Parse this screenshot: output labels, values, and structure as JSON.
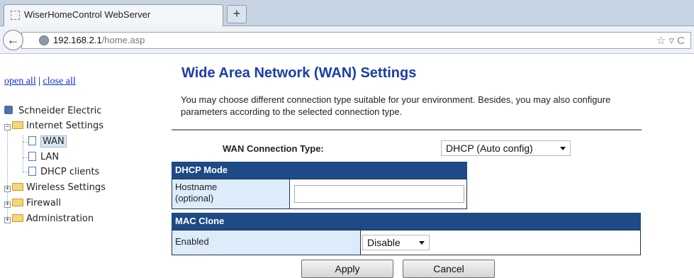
{
  "browser": {
    "tab_title": "WiserHomeControl WebServer",
    "new_tab_label": "+",
    "url_host": "192.168.2.1",
    "url_path": "/home.asp",
    "url_actions": "☆ ▿ C"
  },
  "tree": {
    "open_all": "open all",
    "separator": "|",
    "close_all": "close all",
    "root": "Schneider Electric",
    "internet_settings": "Internet Settings",
    "wan": "WAN",
    "lan": "LAN",
    "dhcp_clients": "DHCP clients",
    "wireless_settings": "Wireless Settings",
    "firewall": "Firewall",
    "administration": "Administration"
  },
  "page": {
    "title": "Wide Area Network (WAN) Settings",
    "description": "You may choose different connection type suitable for your environment. Besides, you may also configure parameters according to the selected connection type."
  },
  "form": {
    "wan_type_label": "WAN Connection Type:",
    "wan_type_value": "DHCP (Auto config)",
    "dhcp_mode_header": "DHCP Mode",
    "hostname_label_1": "Hostname",
    "hostname_label_2": "(optional)",
    "hostname_value": "",
    "mac_clone_header": "MAC Clone",
    "enabled_label": "Enabled",
    "enabled_value": "Disable",
    "apply_label": "Apply",
    "cancel_label": "Cancel"
  },
  "colors": {
    "section_header": "#1e4a86",
    "title": "#1a3ea8",
    "link": "#0b2ec7",
    "label_cell": "#dcecfa"
  }
}
